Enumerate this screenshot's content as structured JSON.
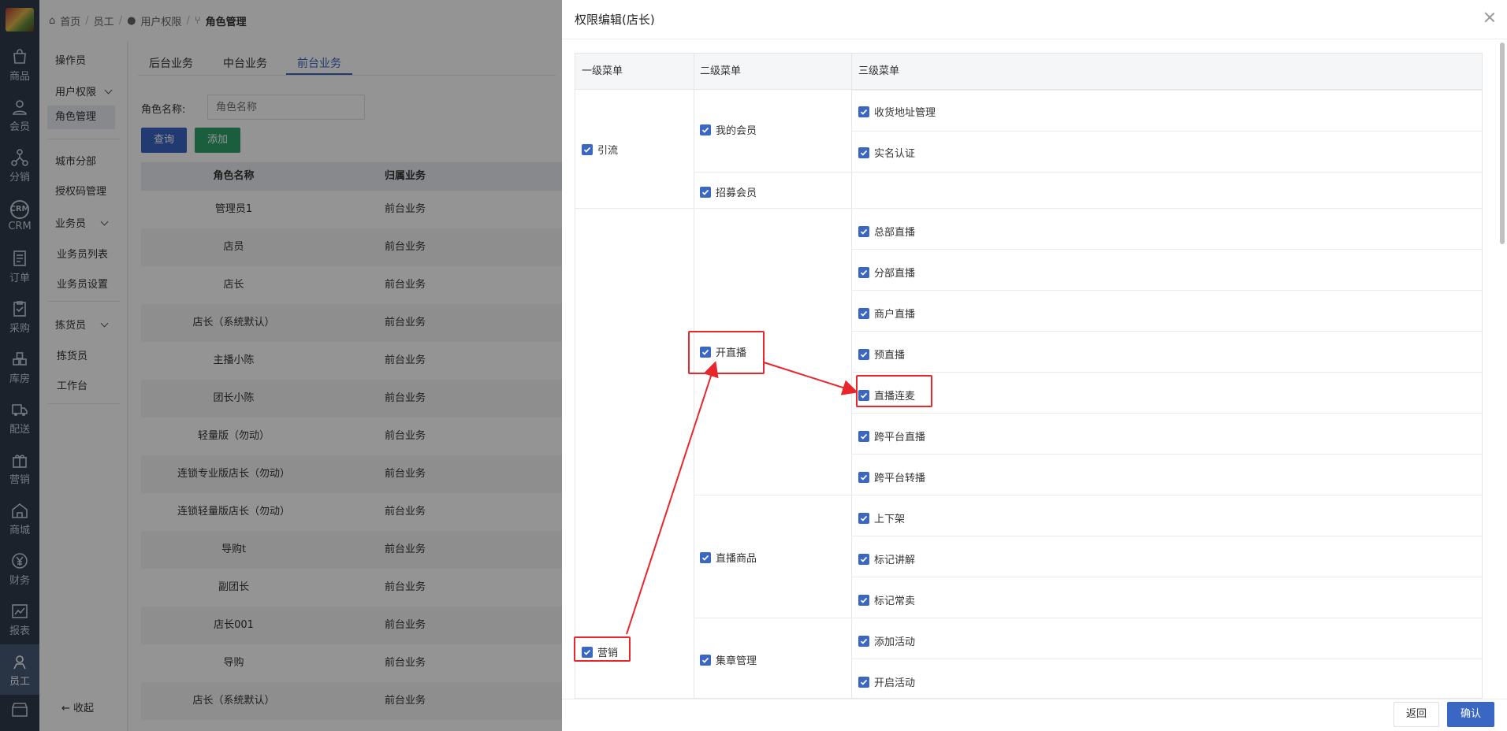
{
  "breadcrumb": {
    "home": "首页",
    "staff": "员工",
    "user_perm": "用户权限",
    "current": "角色管理"
  },
  "nav": [
    {
      "label": "商品",
      "icon": "bag-icon"
    },
    {
      "label": "会员",
      "icon": "user-icon"
    },
    {
      "label": "分销",
      "icon": "share-icon"
    },
    {
      "label": "CRM",
      "icon": "crm-icon"
    },
    {
      "label": "订单",
      "icon": "order-icon"
    },
    {
      "label": "采购",
      "icon": "clipboard-icon"
    },
    {
      "label": "库房",
      "icon": "warehouse-icon"
    },
    {
      "label": "配送",
      "icon": "truck-icon"
    },
    {
      "label": "营销",
      "icon": "gift-icon"
    },
    {
      "label": "商城",
      "icon": "home-icon"
    },
    {
      "label": "财务",
      "icon": "yen-icon"
    },
    {
      "label": "报表",
      "icon": "chart-icon"
    },
    {
      "label": "员工",
      "icon": "staff-icon"
    }
  ],
  "submenu": {
    "operator": "操作员",
    "user_perm": "用户权限",
    "role_mgmt": "角色管理",
    "city_branch": "城市分部",
    "auth_code": "授权码管理",
    "salesman": "业务员",
    "salesman_list": "业务员列表",
    "salesman_settings": "业务员设置",
    "picker": "拣货员",
    "picker_item": "拣货员",
    "workbench": "工作台",
    "collapse": "收起"
  },
  "main": {
    "tabs": [
      "后台业务",
      "中台业务",
      "前台业务"
    ],
    "search_label": "角色名称:",
    "search_placeholder": "角色名称",
    "query": "查询",
    "add": "添加",
    "columns": [
      "角色名称",
      "归属业务"
    ],
    "rows": [
      [
        "管理员1",
        "前台业务"
      ],
      [
        "店员",
        "前台业务"
      ],
      [
        "店长",
        "前台业务"
      ],
      [
        "店长（系统默认）",
        "前台业务"
      ],
      [
        "主播小陈",
        "前台业务"
      ],
      [
        "团长小陈",
        "前台业务"
      ],
      [
        "轻量版（勿动）",
        "前台业务"
      ],
      [
        "连锁专业版店长（勿动）",
        "前台业务"
      ],
      [
        "连锁轻量版店长（勿动）",
        "前台业务"
      ],
      [
        "导购t",
        "前台业务"
      ],
      [
        "副团长",
        "前台业务"
      ],
      [
        "店长001",
        "前台业务"
      ],
      [
        "导购",
        "前台业务"
      ],
      [
        "店长（系统默认）",
        "前台业务"
      ]
    ]
  },
  "drawer": {
    "title": "权限编辑(店长)",
    "col1": "一级菜单",
    "col2": "二级菜单",
    "col3": "三级菜单",
    "l1_yinliu": "引流",
    "l1_yingxiao": "营销",
    "l2_wodehuiyuan": "我的会员",
    "l2_zhaomuhuiyuan": "招募会员",
    "l2_kaizhibo": "开直播",
    "l2_zhiboshangpin": "直播商品",
    "l2_jizhangguanli": "集章管理",
    "l3": [
      "收货地址管理",
      "实名认证",
      "总部直播",
      "分部直播",
      "商户直播",
      "预直播",
      "直播连麦",
      "跨平台直播",
      "跨平台转播",
      "上下架",
      "标记讲解",
      "标记常卖",
      "添加活动",
      "开启活动"
    ],
    "back": "返回",
    "confirm": "确认"
  },
  "colors": {
    "accent": "#3a66c4",
    "annotation": "#e8262b",
    "nav_bg": "#2f3b4c"
  }
}
